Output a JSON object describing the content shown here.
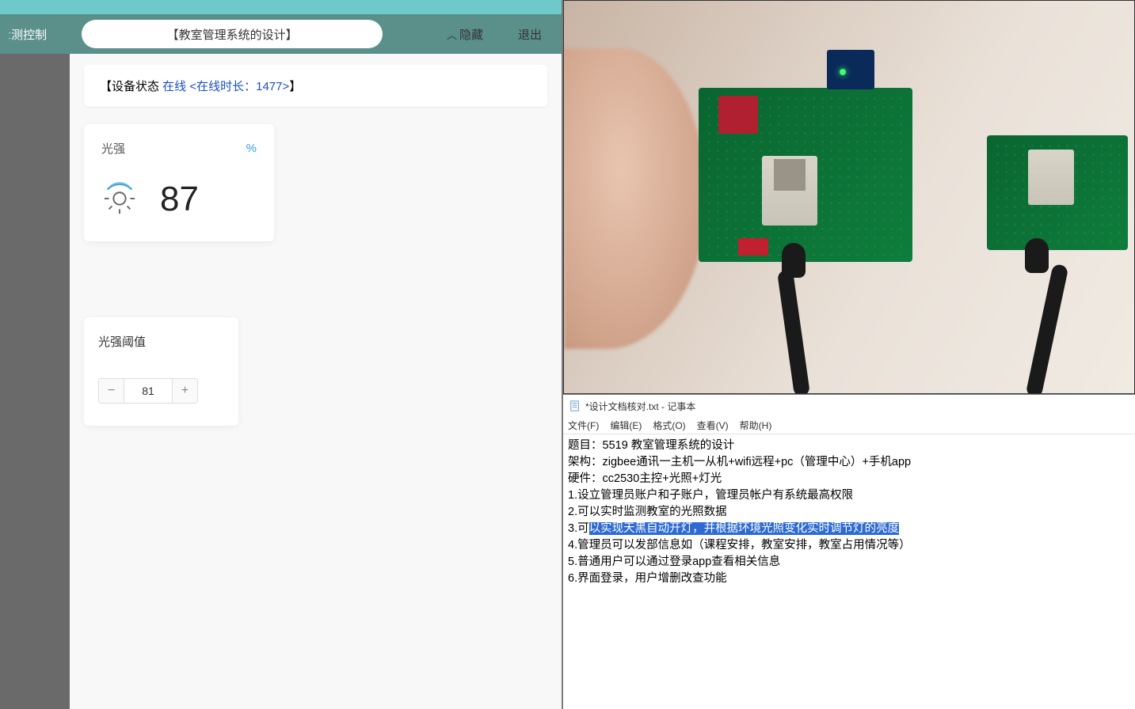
{
  "app": {
    "nav_left": "ː测控制",
    "title": "【教室管理系统的设计】",
    "hide": "隐藏",
    "exit": "退出"
  },
  "status": {
    "prefix": "【设备状态 ",
    "online_text": "在线 <在线时长：1477>",
    "suffix": "】"
  },
  "sensor": {
    "label": "光强",
    "unit": "%",
    "value": "87"
  },
  "threshold": {
    "label": "光强阈值",
    "value": "81"
  },
  "notepad": {
    "title": "*设计文档核对.txt - 记事本",
    "menu": {
      "file": "文件(F)",
      "edit": "编辑(E)",
      "format": "格式(O)",
      "view": "查看(V)",
      "help": "帮助(H)"
    },
    "lines": {
      "l0": "题目：5519 教室管理系统的设计",
      "l1": "架构：zigbee通讯一主机一从机+wifi远程+pc（管理中心）+手机app",
      "l2": "硬件：cc2530主控+光照+灯光",
      "l3": "1.设立管理员账户和子账户，管理员帐户有系统最高权限",
      "l4": "2.可以实时监测教室的光照数据",
      "l5_pre": "3.可",
      "l5_hl": "以实现天黑自动开灯，并根据环境光照变化实时调节灯的亮度",
      "l6": "4.管理员可以发部信息如（课程安排，教室安排，教室占用情况等）",
      "l7": "5.普通用户可以通过登录app查看相关信息",
      "l8": "6.界面登录，用户增删改查功能"
    }
  }
}
